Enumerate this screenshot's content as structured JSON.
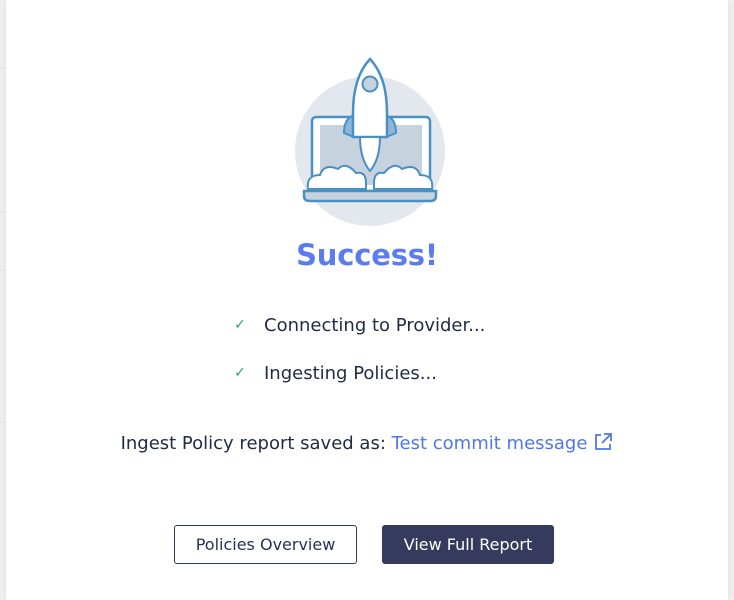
{
  "modal": {
    "illustration": "rocket-launch-laptop-icon",
    "title": "Success!",
    "steps": [
      {
        "icon": "check-icon",
        "label": "Connecting to Provider..."
      },
      {
        "icon": "check-icon",
        "label": "Ingesting Policies..."
      }
    ],
    "report": {
      "prefix": "Ingest Policy report saved as: ",
      "link_text": "Test commit message",
      "link_icon": "external-link-icon"
    },
    "buttons": {
      "secondary": "Policies Overview",
      "primary": "View Full Report"
    }
  },
  "colors": {
    "title": "#5b7cf0",
    "link": "#4f77e6",
    "check": "#1aa37a",
    "primary_button": "#363b5e",
    "text": "#1f2a44"
  }
}
